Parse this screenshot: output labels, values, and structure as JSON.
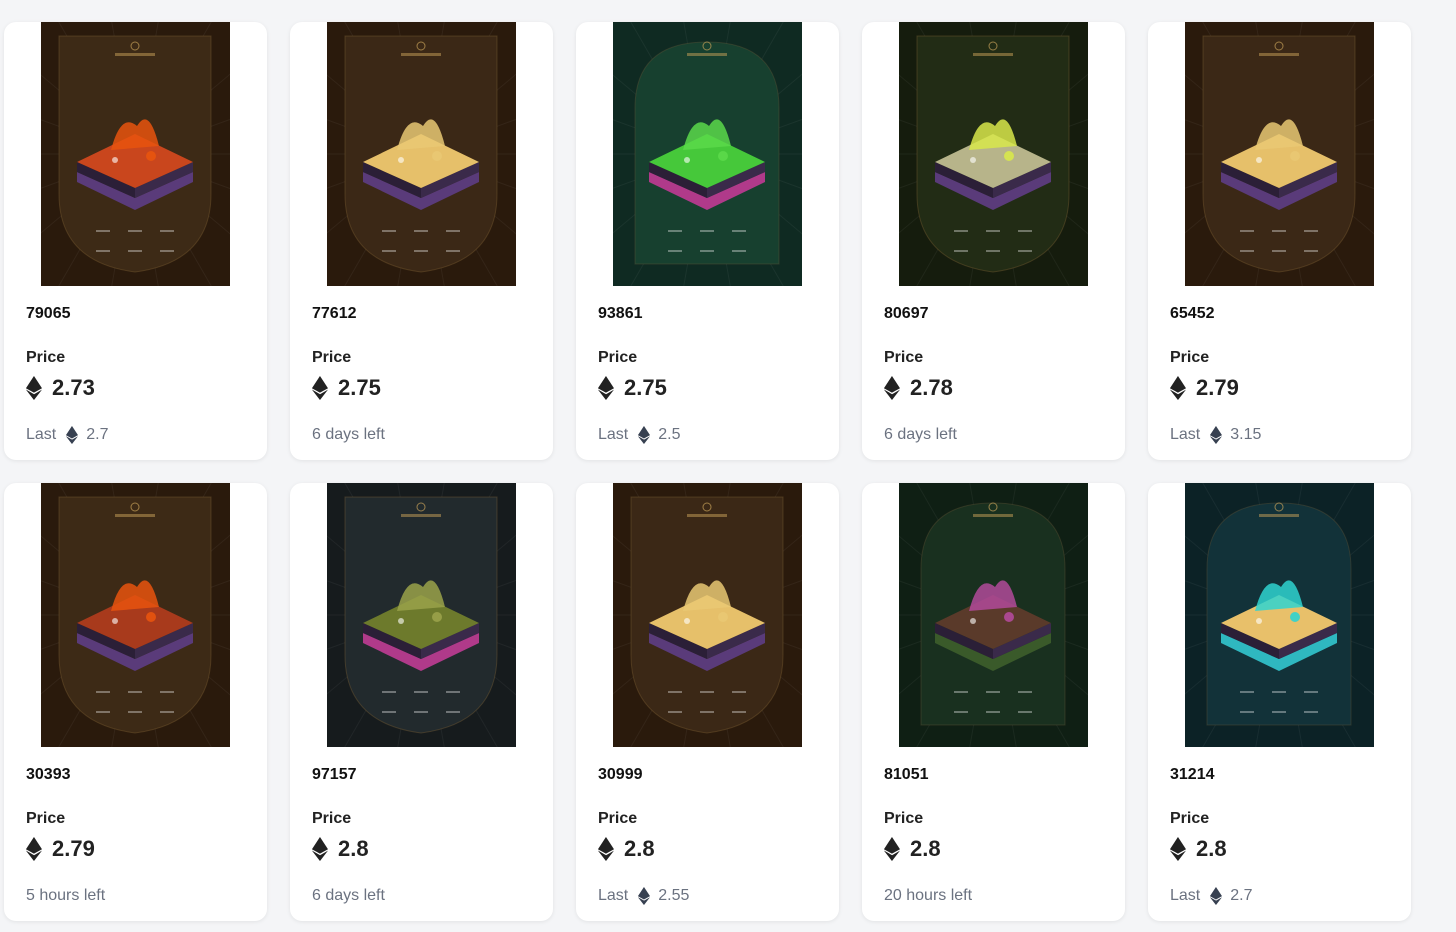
{
  "colors": {
    "price_text": "#222222",
    "muted_text": "#6b7280",
    "card_bg": "#ffffff",
    "page_bg": "#f4f5f7"
  },
  "listings": [
    {
      "id": "79065",
      "price_label": "Price",
      "price": "2.73",
      "footer_type": "last",
      "last_label": "Last",
      "last_value": "2.7",
      "time_left": "",
      "art": {
        "bg": "#2a1a0c",
        "frame": "#3d2a16",
        "shape": "shield",
        "accent": "#e8540e",
        "top": "#c9461d",
        "base": "#5a3b7a"
      }
    },
    {
      "id": "77612",
      "price_label": "Price",
      "price": "2.75",
      "footer_type": "time",
      "last_label": "",
      "last_value": "",
      "time_left": "6 days left",
      "art": {
        "bg": "#2a1a0c",
        "frame": "#3b2816",
        "shape": "shield",
        "accent": "#e9c873",
        "top": "#e6c06a",
        "base": "#5a3b7a"
      }
    },
    {
      "id": "93861",
      "price_label": "Price",
      "price": "2.75",
      "footer_type": "last",
      "last_label": "Last",
      "last_value": "2.5",
      "time_left": "",
      "art": {
        "bg": "#0f2a22",
        "frame": "#17402f",
        "shape": "arch",
        "accent": "#5bd94a",
        "top": "#46c83a",
        "base": "#b03a8a"
      }
    },
    {
      "id": "80697",
      "price_label": "Price",
      "price": "2.78",
      "footer_type": "time",
      "last_label": "",
      "last_value": "",
      "time_left": "6 days left",
      "art": {
        "bg": "#151c0d",
        "frame": "#222c15",
        "shape": "shield",
        "accent": "#d8e84a",
        "top": "#b7b48a",
        "base": "#5a3b7a"
      }
    },
    {
      "id": "65452",
      "price_label": "Price",
      "price": "2.79",
      "footer_type": "last",
      "last_label": "Last",
      "last_value": "3.15",
      "time_left": "",
      "art": {
        "bg": "#2a1a0c",
        "frame": "#3b2816",
        "shape": "shield",
        "accent": "#e9c873",
        "top": "#e6c06a",
        "base": "#5a3b7a"
      }
    },
    {
      "id": "30393",
      "price_label": "Price",
      "price": "2.79",
      "footer_type": "time",
      "last_label": "",
      "last_value": "",
      "time_left": "5 hours left",
      "art": {
        "bg": "#2a1a0c",
        "frame": "#3d2a16",
        "shape": "shield",
        "accent": "#e8540e",
        "top": "#a83a1c",
        "base": "#5a3b7a"
      }
    },
    {
      "id": "97157",
      "price_label": "Price",
      "price": "2.8",
      "footer_type": "time",
      "last_label": "",
      "last_value": "",
      "time_left": "6 days left",
      "art": {
        "bg": "#161b1d",
        "frame": "#222a2d",
        "shape": "shield",
        "accent": "#9aa24a",
        "top": "#6d7a2c",
        "base": "#b03a8a"
      }
    },
    {
      "id": "30999",
      "price_label": "Price",
      "price": "2.8",
      "footer_type": "last",
      "last_label": "Last",
      "last_value": "2.55",
      "time_left": "",
      "art": {
        "bg": "#2a1a0c",
        "frame": "#3b2816",
        "shape": "shield",
        "accent": "#e9c873",
        "top": "#e6c06a",
        "base": "#5a3b7a"
      }
    },
    {
      "id": "81051",
      "price_label": "Price",
      "price": "2.8",
      "footer_type": "time",
      "last_label": "",
      "last_value": "",
      "time_left": "20 hours left",
      "art": {
        "bg": "#0f1f14",
        "frame": "#19301f",
        "shape": "arch",
        "accent": "#b24a9a",
        "top": "#5a3a2a",
        "base": "#3a5a2a"
      }
    },
    {
      "id": "31214",
      "price_label": "Price",
      "price": "2.8",
      "footer_type": "last",
      "last_label": "Last",
      "last_value": "2.7",
      "time_left": "",
      "art": {
        "bg": "#0c2226",
        "frame": "#123239",
        "shape": "arch",
        "accent": "#2fd3d0",
        "top": "#e8c06a",
        "base": "#2fb8c0"
      }
    }
  ]
}
